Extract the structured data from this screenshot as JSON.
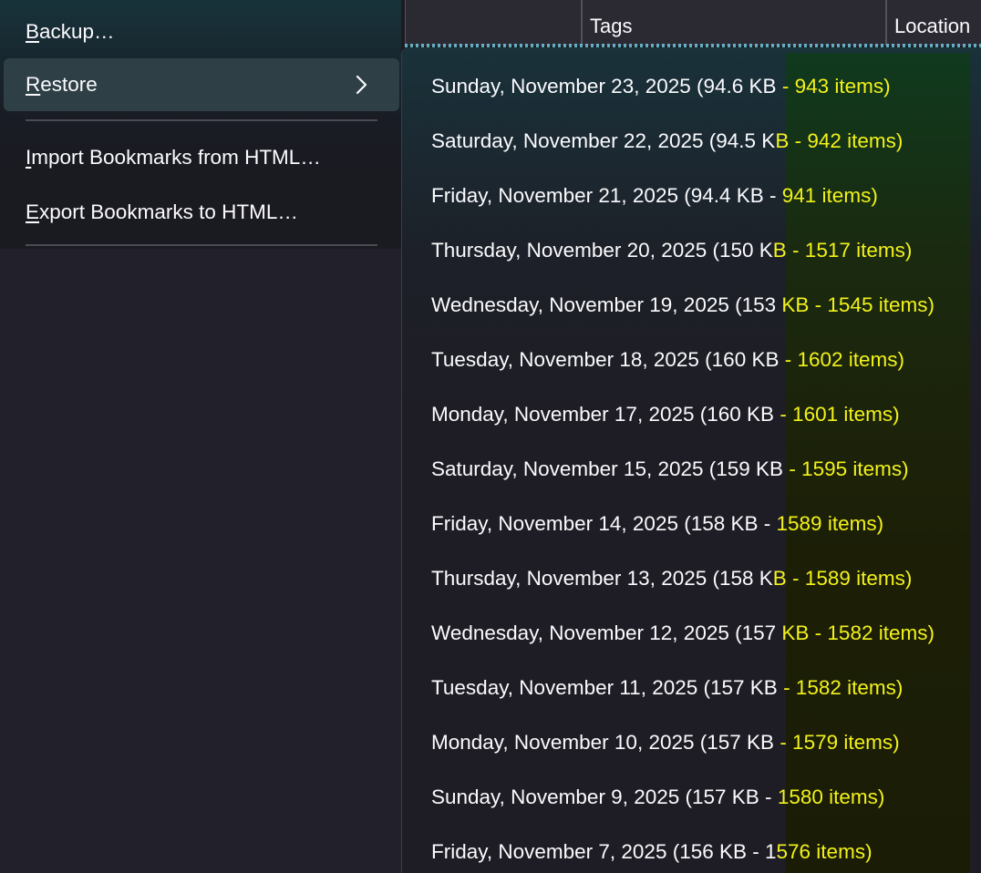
{
  "columns": {
    "tags": "Tags",
    "location": "Location"
  },
  "menu": {
    "backup": {
      "accel": "B",
      "rest": "ackup…"
    },
    "restore": {
      "accel": "R",
      "rest": "estore"
    },
    "import_html": {
      "accel": "I",
      "rest": "mport Bookmarks from HTML…"
    },
    "export_html": {
      "accel": "E",
      "rest": "xport Bookmarks to HTML…"
    }
  },
  "restore_submenu": [
    {
      "label": "Sunday, November 23, 2025 (94.6 KB - 943 items)"
    },
    {
      "label": "Saturday, November 22, 2025 (94.5 KB - 942 items)"
    },
    {
      "label": "Friday, November 21, 2025 (94.4 KB - 941 items)"
    },
    {
      "label": "Thursday, November 20, 2025 (150 KB - 1517 items)"
    },
    {
      "label": "Wednesday, November 19, 2025 (153 KB - 1545 items)"
    },
    {
      "label": "Tuesday, November 18, 2025 (160 KB - 1602 items)"
    },
    {
      "label": "Monday, November 17, 2025 (160 KB - 1601 items)"
    },
    {
      "label": "Saturday, November 15, 2025 (159 KB - 1595 items)"
    },
    {
      "label": "Friday, November 14, 2025 (158 KB - 1589 items)"
    },
    {
      "label": "Thursday, November 13, 2025 (158 KB - 1589 items)"
    },
    {
      "label": "Wednesday, November 12, 2025 (157 KB - 1582 items)"
    },
    {
      "label": "Tuesday, November 11, 2025 (157 KB - 1582 items)"
    },
    {
      "label": "Monday, November 10, 2025 (157 KB - 1579 items)"
    },
    {
      "label": "Sunday, November 9, 2025 (157 KB - 1580 items)"
    },
    {
      "label": "Friday, November 7, 2025 (156 KB - 1576 items)"
    }
  ],
  "colors": {
    "highlight_text": "#f2f21a",
    "menu_bg": "#1a1a21",
    "active_item_bg": "#2e3f46"
  },
  "icons": {
    "restore_chevron": "chevron-right-icon"
  }
}
